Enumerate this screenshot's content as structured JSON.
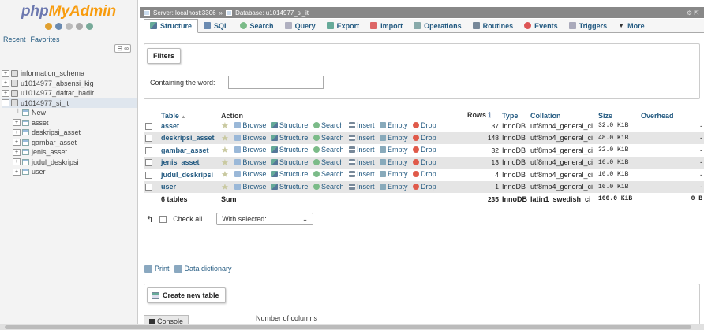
{
  "nav": {
    "logo_php": "php",
    "logo_mya": "MyAdmin",
    "recent": "Recent",
    "favorites": "Favorites",
    "collapse_link": "⊟ ∞",
    "databases": [
      {
        "name": "information_schema",
        "expanded": false
      },
      {
        "name": "u1014977_absensi_kig",
        "expanded": false
      },
      {
        "name": "u1014977_daftar_hadir",
        "expanded": false
      },
      {
        "name": "u1014977_si_it",
        "expanded": true
      }
    ],
    "new_label": "New",
    "tables": [
      "asset",
      "deskripsi_asset",
      "gambar_asset",
      "jenis_asset",
      "judul_deskripsi",
      "user"
    ]
  },
  "breadcrumb": {
    "server": "Server: localhost:3306",
    "sep": "»",
    "database": "Database: u1014977_si_it",
    "right": "⚙ ⇱"
  },
  "tabs": [
    {
      "label": "Structure",
      "icon": "structure-icon",
      "color": "#5a9a6a",
      "active": true
    },
    {
      "label": "SQL",
      "icon": "sql-icon",
      "color": "#6a8ab0",
      "active": false
    },
    {
      "label": "Search",
      "icon": "search-icon",
      "color": "#7bbb88",
      "active": false
    },
    {
      "label": "Query",
      "icon": "query-icon",
      "color": "#b0b0c0",
      "active": false
    },
    {
      "label": "Export",
      "icon": "export-icon",
      "color": "#6a9",
      "active": false
    },
    {
      "label": "Import",
      "icon": "import-icon",
      "color": "#d66",
      "active": false
    },
    {
      "label": "Operations",
      "icon": "wrench-icon",
      "color": "#8aa",
      "active": false
    },
    {
      "label": "Routines",
      "icon": "routines-icon",
      "color": "#789",
      "active": false
    },
    {
      "label": "Events",
      "icon": "clock-icon",
      "color": "#d55",
      "active": false
    },
    {
      "label": "Triggers",
      "icon": "triggers-icon",
      "color": "#aab",
      "active": false
    },
    {
      "label": "More",
      "icon": "caret-icon",
      "color": "#333",
      "active": false
    }
  ],
  "filters": {
    "title": "Filters",
    "label": "Containing the word:",
    "value": ""
  },
  "table": {
    "headers": {
      "table": "Table",
      "sort_icon": "▲",
      "action": "Action",
      "rows": "Rows",
      "rows_help_icon": "ℹ",
      "type": "Type",
      "collation": "Collation",
      "size": "Size",
      "overhead": "Overhead"
    },
    "actions": {
      "browse": "Browse",
      "structure": "Structure",
      "search": "Search",
      "insert": "Insert",
      "empty": "Empty",
      "drop": "Drop"
    },
    "rows": [
      {
        "name": "asset",
        "rows": "37",
        "type": "InnoDB",
        "collation": "utf8mb4_general_ci",
        "size": "32.0 KiB",
        "overhead": "-"
      },
      {
        "name": "deskripsi_asset",
        "rows": "148",
        "type": "InnoDB",
        "collation": "utf8mb4_general_ci",
        "size": "48.0 KiB",
        "overhead": "-"
      },
      {
        "name": "gambar_asset",
        "rows": "32",
        "type": "InnoDB",
        "collation": "utf8mb4_general_ci",
        "size": "32.0 KiB",
        "overhead": "-"
      },
      {
        "name": "jenis_asset",
        "rows": "13",
        "type": "InnoDB",
        "collation": "utf8mb4_general_ci",
        "size": "16.0 KiB",
        "overhead": "-"
      },
      {
        "name": "judul_deskripsi",
        "rows": "4",
        "type": "InnoDB",
        "collation": "utf8mb4_general_ci",
        "size": "16.0 KiB",
        "overhead": "-"
      },
      {
        "name": "user",
        "rows": "1",
        "type": "InnoDB",
        "collation": "utf8mb4_general_ci",
        "size": "16.0 KiB",
        "overhead": "-"
      }
    ],
    "summary": {
      "count": "6 tables",
      "sum": "Sum",
      "rows": "235",
      "type": "InnoDB",
      "collation": "latin1_swedish_ci",
      "size": "160.0 KiB",
      "overhead": "0 B"
    }
  },
  "bulk": {
    "check_all": "Check all",
    "with_selected": "With selected:",
    "caret": "⌄"
  },
  "links": {
    "print": "Print",
    "data_dictionary": "Data dictionary"
  },
  "create": {
    "title": "Create new table",
    "num_columns_label": "Number of columns"
  },
  "console": {
    "label": "Console"
  }
}
